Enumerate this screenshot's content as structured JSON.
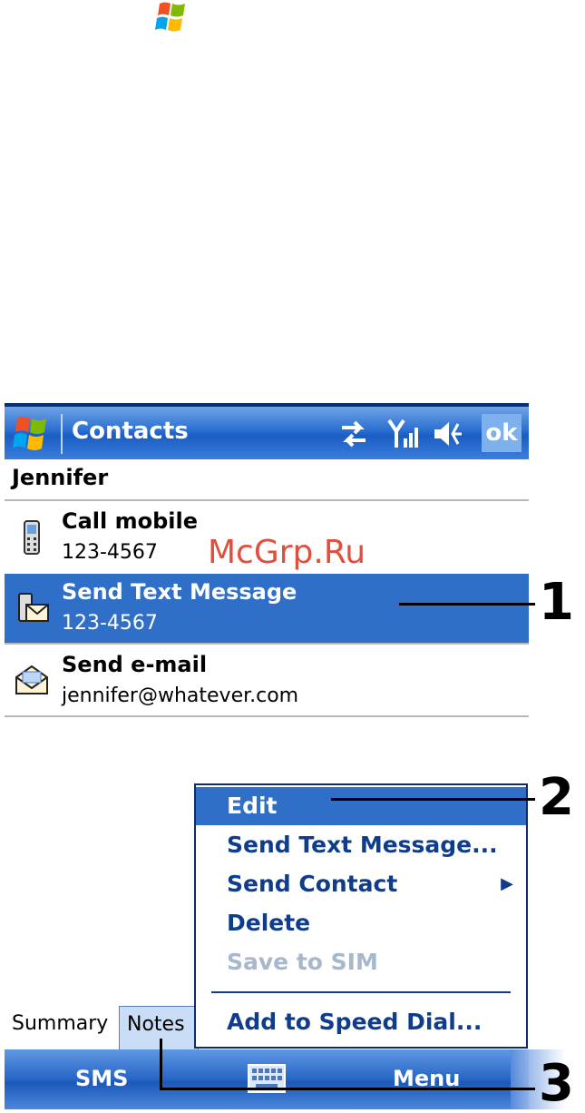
{
  "watermark": "McGrp.Ru",
  "titlebar": {
    "title": "Contacts",
    "ok_label": "ok"
  },
  "contact": {
    "name": "Jennifer"
  },
  "items": [
    {
      "title": "Call mobile",
      "detail": "123-4567",
      "icon": "mobile-phone-icon"
    },
    {
      "title": "Send Text Message",
      "detail": "123-4567",
      "icon": "text-message-icon"
    },
    {
      "title": "Send e-mail",
      "detail": "jennifer@whatever.com",
      "icon": "email-envelope-icon"
    }
  ],
  "menu": {
    "items": [
      {
        "label": "Edit",
        "state": "selected"
      },
      {
        "label": "Send Text Message...",
        "state": "normal"
      },
      {
        "label": "Send Contact",
        "state": "normal",
        "submenu": true
      },
      {
        "label": "Delete",
        "state": "normal"
      },
      {
        "label": "Save to SIM",
        "state": "disabled"
      },
      {
        "label": "Add to Speed Dial...",
        "state": "normal"
      }
    ]
  },
  "tabs": {
    "summary": "Summary",
    "notes": "Notes"
  },
  "softkeys": {
    "left": "SMS",
    "right": "Menu"
  },
  "callouts": [
    "1",
    "2",
    "3"
  ],
  "colors": {
    "title_bar": "#2a6fd1",
    "selection": "#2f6fc8",
    "menu_text": "#0f3d8c"
  }
}
